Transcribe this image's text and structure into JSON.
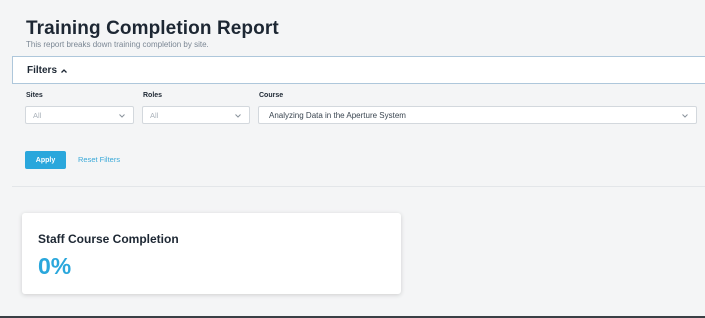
{
  "header": {
    "title": "Training Completion Report",
    "subtitle": "This report breaks down training completion by site."
  },
  "filters": {
    "toggle_label": "Filters",
    "toggle_icon": "chevron-up-icon",
    "sites": {
      "label": "Sites",
      "value": "All"
    },
    "roles": {
      "label": "Roles",
      "value": "All"
    },
    "course": {
      "label": "Course",
      "value": "Analyzing Data in the Aperture System"
    },
    "apply_label": "Apply",
    "reset_label": "Reset Filters"
  },
  "card": {
    "title": "Staff Course Completion",
    "value": "0%"
  },
  "colors": {
    "accent": "#2aa7dc",
    "background": "#f4f5f6",
    "filter_border": "#aec7db"
  }
}
